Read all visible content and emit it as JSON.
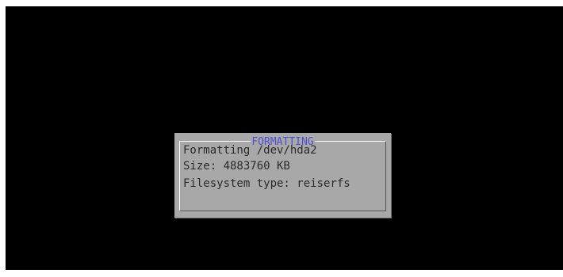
{
  "dialog": {
    "title": "FORMATTING",
    "lines": [
      "Formatting /dev/hda2",
      "Size: 4883760 KB",
      "Filesystem type: reiserfs"
    ]
  },
  "colors": {
    "screen_background": "#000000",
    "dialog_background": "#a8a8a8",
    "title_color": "#4f4fd2",
    "text_color": "#2a2a2a",
    "frame_highlight": "#ffffff"
  }
}
